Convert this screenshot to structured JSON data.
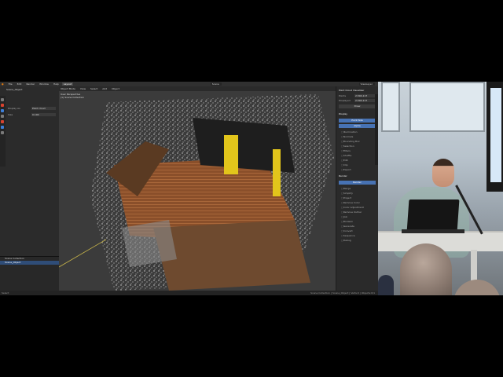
{
  "menubar": {
    "items": [
      "File",
      "Edit",
      "Render",
      "Window",
      "Help"
    ],
    "workspace_tab": "Layout",
    "scene": "Scene",
    "view_layer": "ViewLayer"
  },
  "viewport": {
    "header_items": [
      "Object Mode",
      "View",
      "Select",
      "Add",
      "Object"
    ],
    "info_line1": "User Perspective",
    "info_line2": "(1) Scene Collection"
  },
  "left_panel": {
    "header": "Scene_Object",
    "rows": [
      {
        "label": "Display As",
        "value": "Point cloud"
      },
      {
        "label": "Size",
        "value": "0.100"
      }
    ],
    "outliner": [
      "Scene Collection",
      "Scene_Object"
    ]
  },
  "right_panel": {
    "title": "Point Cloud Visualizer",
    "rows": [
      {
        "label": "Points",
        "value": "2,594,117"
      },
      {
        "label": "Displayed",
        "value": "2,594,117"
      }
    ],
    "draw_button": "Draw",
    "section_display": "Display",
    "buttons": [
      "Point Size",
      "Alpha"
    ],
    "checks": [
      "Illumination",
      "Normals",
      "Bounding Box",
      "Selection",
      "Filters",
      "Shuffle",
      "Edit",
      "Clip",
      "Export"
    ],
    "section_render": "Render",
    "render_button": "Render",
    "more_checks": [
      "Merge",
      "Simplify",
      "Project",
      "Remove Color",
      "Color Adjustment",
      "Remove Outlier",
      "Join",
      "Boolean",
      "Generate",
      "Convert",
      "Sequence",
      "Debug"
    ]
  },
  "statusbar": {
    "left": "Select",
    "right": "Scene Collection | Scene_Object | Verts:0 | Objects:0/1"
  },
  "colors": {
    "accent": "#4772b3",
    "background": "#1d1d1d"
  }
}
